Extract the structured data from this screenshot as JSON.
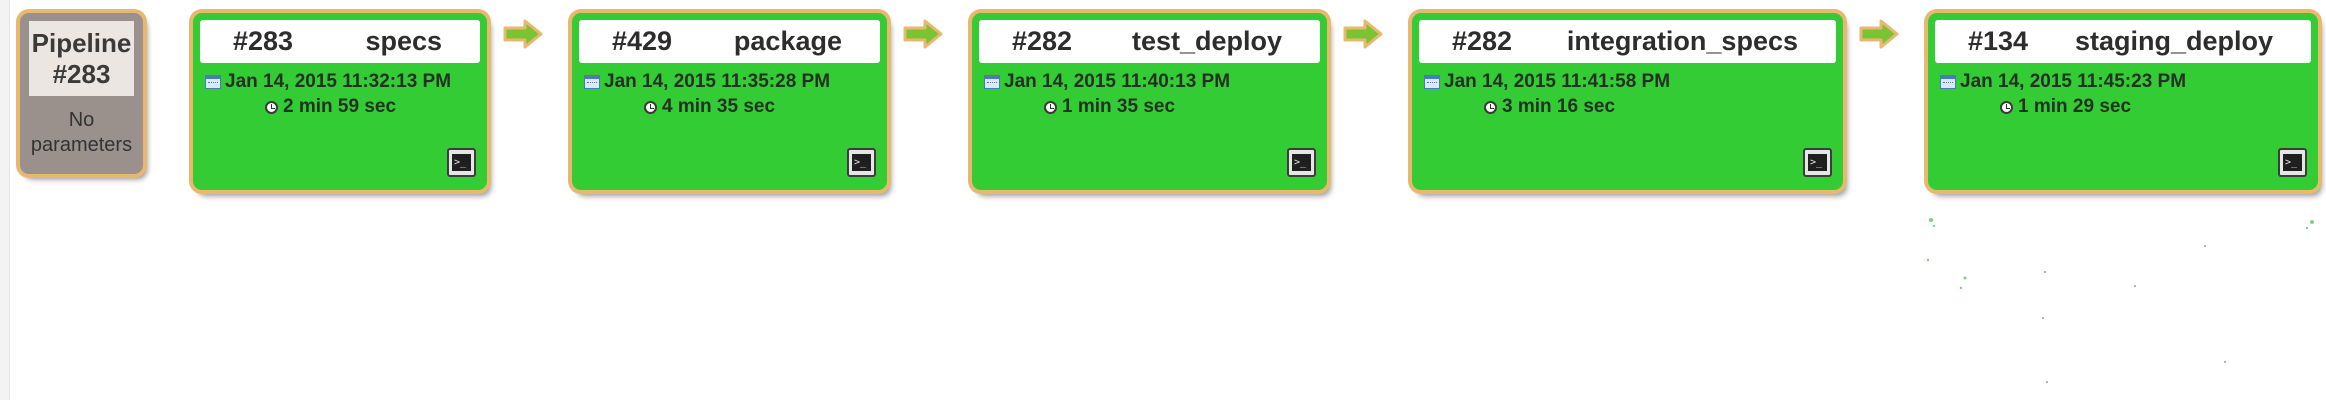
{
  "pipeline": {
    "title": "Pipeline #283",
    "params_text": "No parameters"
  },
  "stages": [
    {
      "number": "#283",
      "name": "specs",
      "date": "Jan 14, 2015 11:32:13 PM",
      "duration": "2 min 59 sec"
    },
    {
      "number": "#429",
      "name": "package",
      "date": "Jan 14, 2015 11:35:28 PM",
      "duration": "4 min 35 sec"
    },
    {
      "number": "#282",
      "name": "test_deploy",
      "date": "Jan 14, 2015 11:40:13 PM",
      "duration": "1 min 35 sec"
    },
    {
      "number": "#282",
      "name": "integration_specs",
      "date": "Jan 14, 2015 11:41:58 PM",
      "duration": "3 min 16 sec"
    },
    {
      "number": "#134",
      "name": "staging_deploy",
      "date": "Jan 14, 2015 11:45:23 PM",
      "duration": "1 min 29 sec"
    }
  ],
  "colors": {
    "success": "#34cc34",
    "card_border": "#e8b86f",
    "pipeline_card": "#9a918d",
    "arrow": "#7cc334"
  },
  "icons": {
    "date": "calendar-icon",
    "duration": "clock-icon",
    "console": "console-icon",
    "connector": "arrow-right-icon"
  }
}
